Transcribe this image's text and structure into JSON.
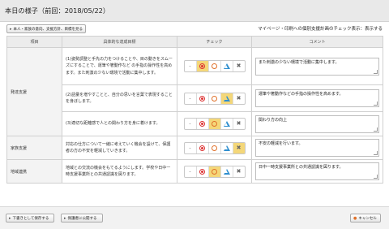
{
  "title": "本日の様子（前回：2018/05/22）",
  "top_button_label": "本人・家族の意向、支援方針、目標を見る",
  "top_note": "マイページ・印刷への個別支援計画のチェック表示：表示する",
  "table": {
    "headers": [
      "項目",
      "具体的な達成目標",
      "チェック",
      "コメント"
    ],
    "check_symbols": [
      "-",
      "◎",
      "○",
      "△",
      "✖"
    ],
    "categories": [
      {
        "label": "発達支援"
      },
      {
        "label": "家族支援"
      },
      {
        "label": "地域連携"
      }
    ],
    "rows": [
      {
        "goal": "(1)姿勢調整と手先の力をつけることや、目の動きをスムーズにすることで、運筆や箸動作など の手指の操作性を高めます。また刺激の少ない環境で活動に集中します。",
        "selected": 1,
        "comment": "また刺激の少ない環境で活動に集中します。"
      },
      {
        "goal": "(2)語彙を増やすことと、自分の思いを言葉で表現することを身ぼします。",
        "selected": 3,
        "comment": "運筆や箸動作などの手指の操作性を高めます。"
      },
      {
        "goal": "(3)適切な距離感で人との関わり方を身に着けます。",
        "selected": 2,
        "comment": "関わり方の向上"
      },
      {
        "goal": "対応の仕方について一緒に考えていく機会を設けて、保護者の方の不安を軽減していきます。",
        "selected": 4,
        "comment": "不安の軽減を行います。"
      },
      {
        "goal": "地域との交流の機会をもてるようにします。学校や日中一時支援事業所との共通認識を図ります。",
        "selected": 2,
        "comment": "日中一時支援事業所との共通認識を図ります。"
      }
    ]
  },
  "bottom": {
    "save_draft": "下書きとして保存する",
    "publish": "保護者に公開する",
    "cancel": "キャンセル"
  },
  "colors": {
    "selected_bg": "#f4d779",
    "double_circle": "#dd3333",
    "circle": "#e0712a",
    "triangle": "#2f8fcf"
  }
}
